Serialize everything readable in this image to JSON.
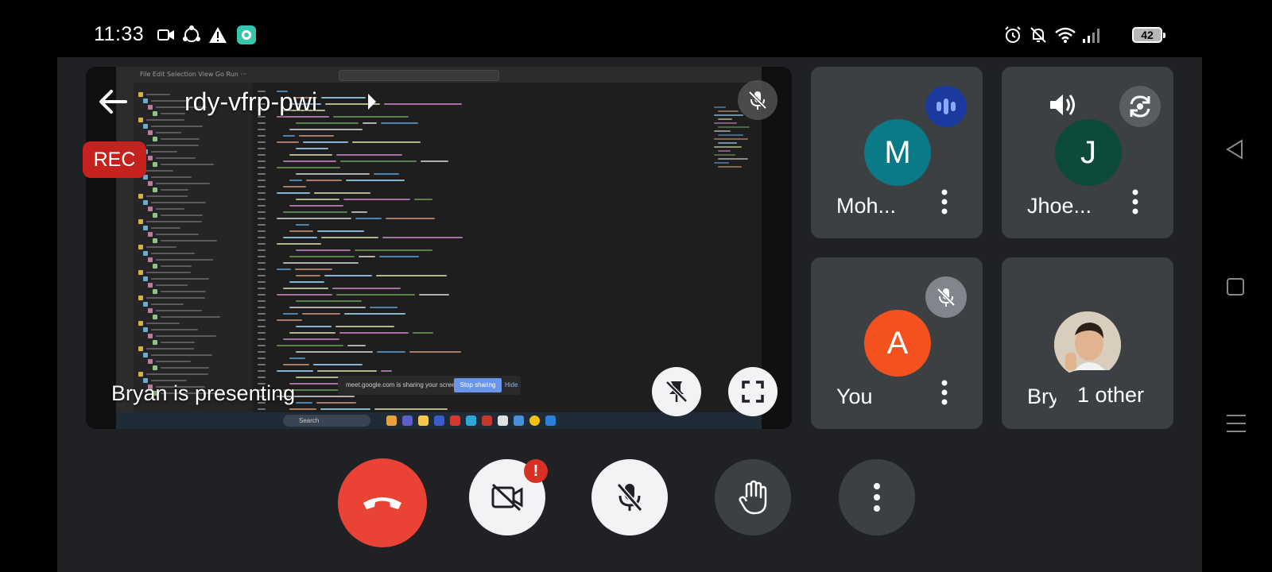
{
  "status_bar": {
    "time": "11:33",
    "battery": "42",
    "left_icons": [
      "video-camera-icon",
      "share-icon",
      "warning-icon",
      "app-notification-icon"
    ],
    "right_icons": [
      "alarm-icon",
      "bell-off-icon",
      "wifi-icon",
      "signal-icon",
      "battery-icon"
    ]
  },
  "meeting": {
    "code": "rdy-vfrp-pwi",
    "recording_label": "REC",
    "presenting_label": "Bryan is presenting",
    "screen_share_bar": {
      "message": "meet.google.com is sharing your screen.",
      "stop_label": "Stop sharing",
      "hide_label": "Hide"
    },
    "shared_screen": {
      "editor_menu": "File  Edit  Selection  View  Go  Run  ···",
      "taskbar_search": "Search"
    }
  },
  "participants": [
    {
      "name": "Moh...",
      "initial": "M",
      "avatar_color": "#0b7a87",
      "status_icon": "speaking-icon"
    },
    {
      "name": "Jhoe...",
      "initial": "J",
      "avatar_color": "#0d4a3a",
      "status_icon": "rotate-camera-icon"
    },
    {
      "name": "You",
      "initial": "A",
      "avatar_color": "#f4511e",
      "status_icon": "mic-off-icon"
    },
    {
      "name": "Brya",
      "initial": "",
      "avatar_color": "#c9b5a0",
      "status_icon": "photo-avatar"
    }
  ],
  "other_count_label": "1 other",
  "controls": {
    "end_call_color": "#ea4335",
    "camera_alert": "!"
  },
  "colors": {
    "app_background": "#202124",
    "tile_background": "#3c4043",
    "rec_red": "#c5221f",
    "speaking_blue": "#1a3aa0"
  }
}
